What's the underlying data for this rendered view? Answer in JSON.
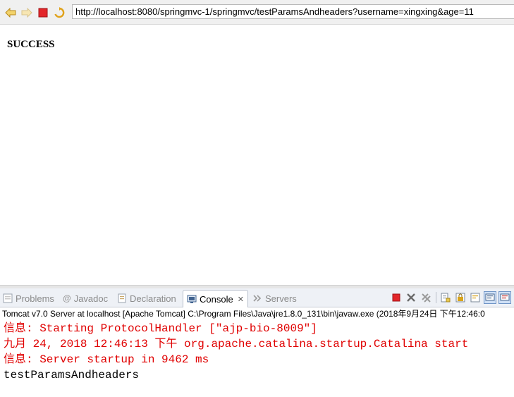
{
  "browser": {
    "url": "http://localhost:8080/springmvc-1/springmvc/testParamsAndheaders?username=xingxing&age=11"
  },
  "page": {
    "heading": "SUCCESS"
  },
  "console_view": {
    "tabs": [
      {
        "label": "Problems",
        "icon": "problems-icon",
        "active": false
      },
      {
        "label": "Javadoc",
        "icon": "javadoc-icon",
        "active": false
      },
      {
        "label": "Declaration",
        "icon": "declaration-icon",
        "active": false
      },
      {
        "label": "Console",
        "icon": "console-icon",
        "active": true
      },
      {
        "label": "Servers",
        "icon": "servers-icon",
        "active": false
      }
    ],
    "process_label": "Tomcat v7.0 Server at localhost [Apache Tomcat] C:\\Program Files\\Java\\jre1.8.0_131\\bin\\javaw.exe (2018年9月24日 下午12:46:0",
    "lines": [
      {
        "text": "信息: Starting ProtocolHandler [\"ajp-bio-8009\"]",
        "stream": "err"
      },
      {
        "text": "九月 24, 2018 12:46:13 下午 org.apache.catalina.startup.Catalina start",
        "stream": "err"
      },
      {
        "text": "信息: Server startup in 9462 ms",
        "stream": "err"
      },
      {
        "text": "testParamsAndheaders",
        "stream": "out"
      }
    ]
  },
  "colors": {
    "stderr": "#e00000",
    "stdout": "#000000",
    "tab_bar": "#eef1f6"
  }
}
